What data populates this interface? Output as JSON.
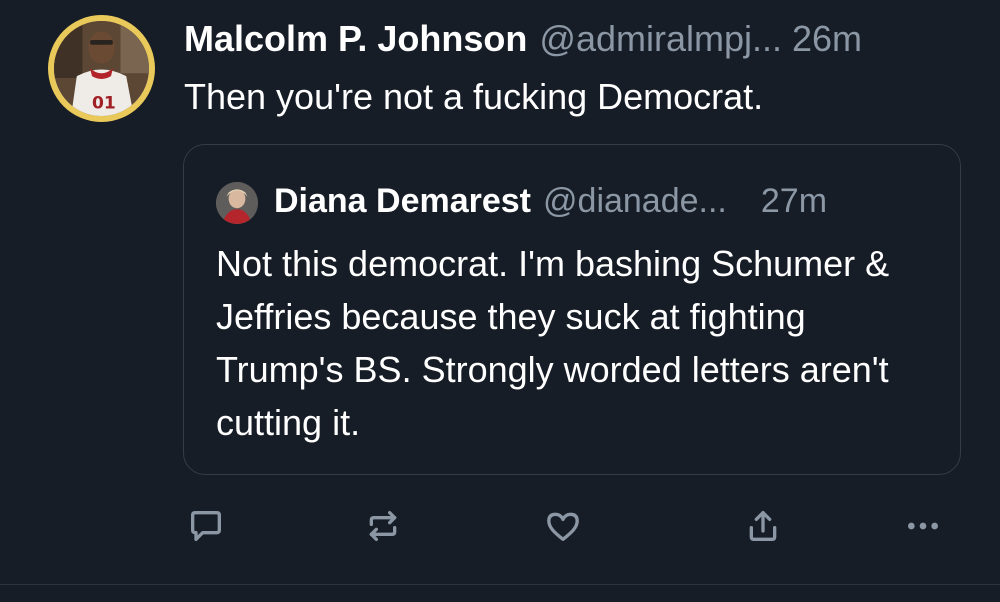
{
  "post": {
    "author_name": "Malcolm P. Johnson",
    "author_handle": "@admiralmpj...",
    "timestamp": "26m",
    "text": "Then you're not a fucking Democrat."
  },
  "quoted_post": {
    "author_name": "Diana Demarest",
    "author_handle": "@dianade...",
    "timestamp": "27m",
    "text": "Not this democrat. I'm bashing Schumer & Jeffries because they suck at fighting Trump's BS. Strongly worded letters aren't cutting it."
  },
  "actions": [
    {
      "name": "reply",
      "icon": "reply-icon"
    },
    {
      "name": "repost",
      "icon": "repost-icon"
    },
    {
      "name": "like",
      "icon": "heart-icon"
    },
    {
      "name": "share",
      "icon": "share-icon"
    },
    {
      "name": "more",
      "icon": "more-icon"
    }
  ],
  "colors": {
    "background": "#171d26",
    "text_primary": "#ffffff",
    "text_secondary": "#8b97a5",
    "border": "#343c48",
    "avatar_ring": "#e9c95a"
  }
}
